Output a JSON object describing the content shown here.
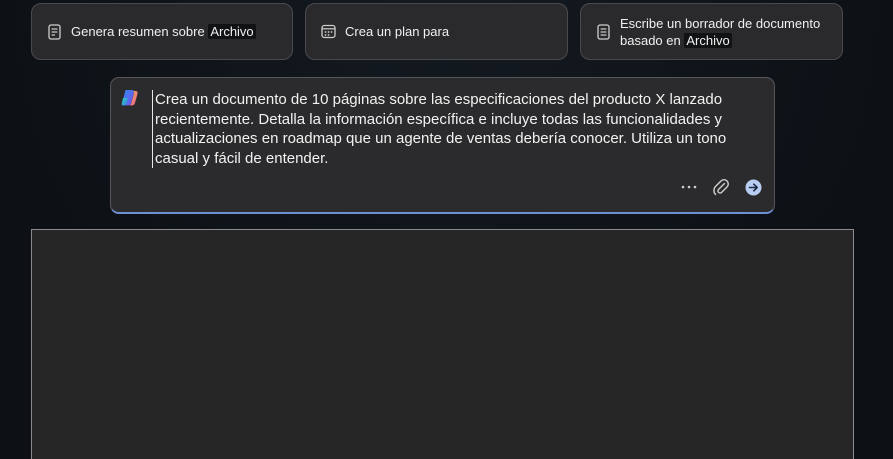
{
  "suggestions": [
    {
      "icon": "document-icon",
      "text": "Genera resumen sobre",
      "ref": "Archivo",
      "ref_line2": ""
    },
    {
      "icon": "calendar-icon",
      "text": "Crea un plan para",
      "ref": "",
      "ref_line2": ""
    },
    {
      "icon": "document-lines-icon",
      "text": "Escribe un borrador de documento",
      "text_line2": "basado en",
      "ref": "Archivo"
    }
  ],
  "prompt": {
    "logo": "copilot-logo",
    "text": "Crea un documento de 10 páginas sobre las especificaciones del producto X lanzado recientemente. Detalla la información específica e incluye todas las funcionalidades y actualizaciones en roadmap que un agente de ventas debería conocer. Utiliza un tono casual y fácil de entender.",
    "actions": [
      "more-options-icon",
      "attach-icon",
      "send-icon"
    ]
  },
  "colors": {
    "background": "#0f1318",
    "card": "#2a2a2c",
    "accent": "#6f8fd4",
    "send": "#b9cdf2"
  }
}
